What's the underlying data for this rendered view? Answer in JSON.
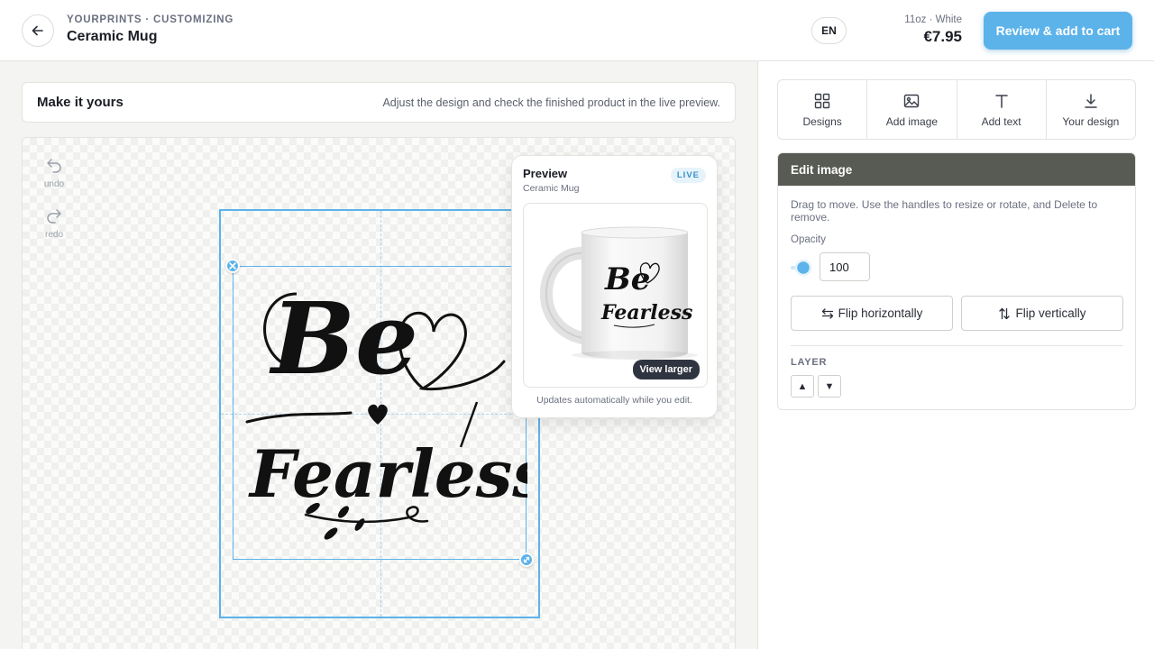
{
  "header": {
    "breadcrumb": "YOURPRINTS · CUSTOMIZING",
    "product_title": "Ceramic Mug",
    "language": "EN",
    "variant": "11oz · White",
    "price": "€7.95",
    "cart_button": "Review & add to cart"
  },
  "intro": {
    "title": "Make it yours",
    "hint": "Adjust the design and check the finished product in the live preview."
  },
  "history": {
    "undo_label": "undo",
    "redo_label": "redo"
  },
  "design": {
    "line1": "Be",
    "line2": "Fearless"
  },
  "preview": {
    "title": "Preview",
    "subtitle": "Ceramic Mug",
    "badge": "LIVE",
    "view_larger": "View larger",
    "note": "Updates automatically while you edit."
  },
  "tools": [
    {
      "label": "Designs",
      "icon": "grid-icon"
    },
    {
      "label": "Add image",
      "icon": "image-icon"
    },
    {
      "label": "Add text",
      "icon": "text-icon"
    },
    {
      "label": "Your design",
      "icon": "download-icon"
    }
  ],
  "edit_panel": {
    "title": "Edit image",
    "help": "Drag to move. Use the handles to resize or rotate, and Delete to remove.",
    "opacity_label": "Opacity",
    "opacity_value": "100",
    "flip_horizontal": "Flip horizontally",
    "flip_vertical": "Flip vertically",
    "layer_label": "LAYER",
    "layer_up": "▲",
    "layer_down": "▼"
  },
  "colors": {
    "accent": "#5cb3ea",
    "panel_header": "#585a54"
  }
}
